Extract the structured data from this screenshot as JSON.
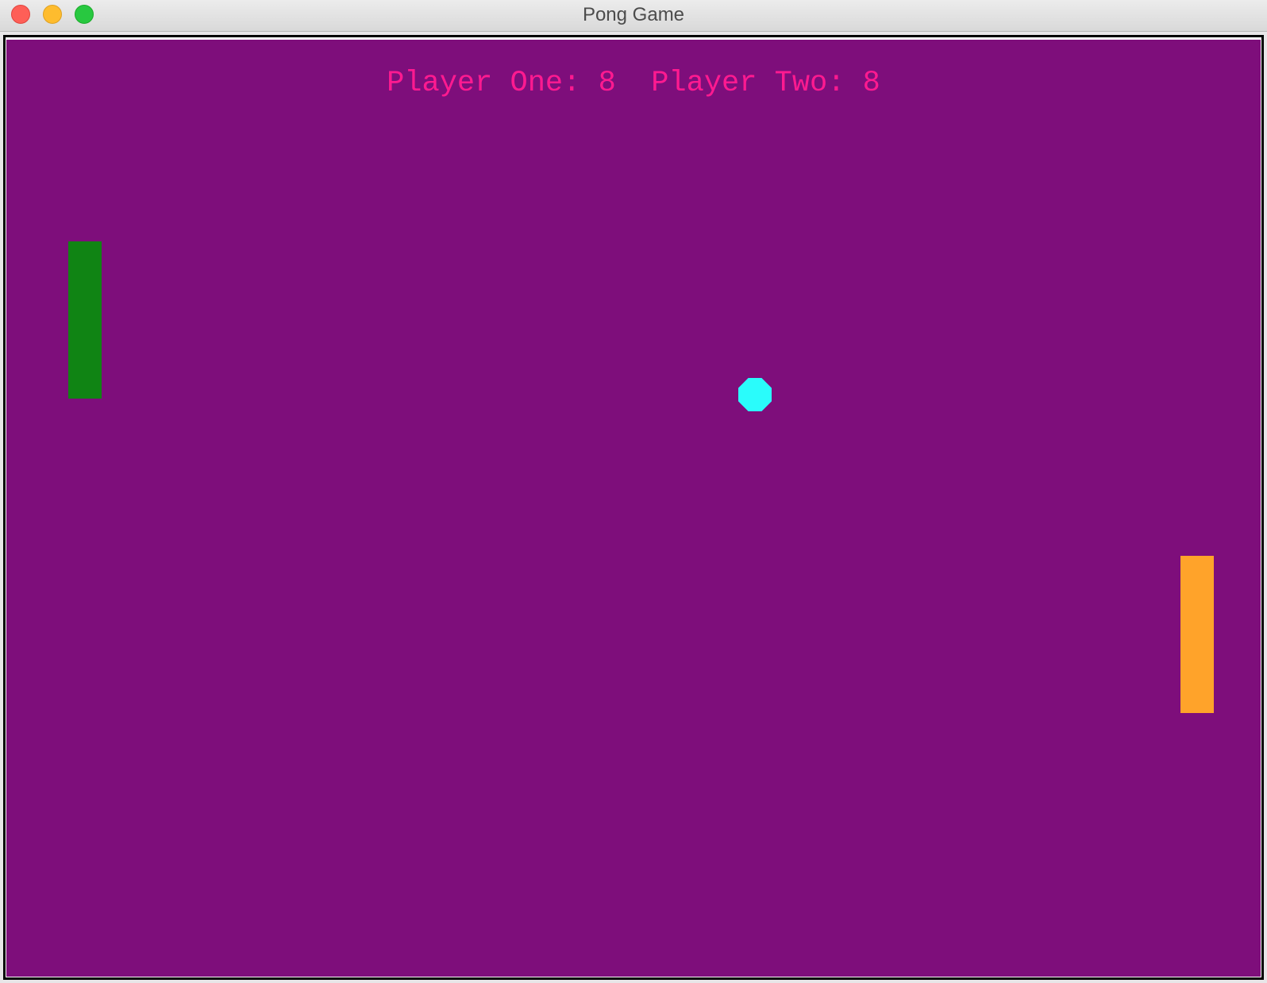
{
  "window": {
    "title": "Pong Game",
    "controls": {
      "close_icon": "close-icon",
      "minimize_icon": "minimize-icon",
      "maximize_icon": "maximize-icon"
    }
  },
  "scoreboard": {
    "player_one_label": "Player One:",
    "player_one_score": "8",
    "player_two_label": "Player Two:",
    "player_two_score": "8"
  },
  "colors": {
    "court_background": "#7e0e7b",
    "score_text": "#ff1a90",
    "left_paddle": "#108414",
    "right_paddle": "#ffa32a",
    "ball": "#2afcfb"
  }
}
